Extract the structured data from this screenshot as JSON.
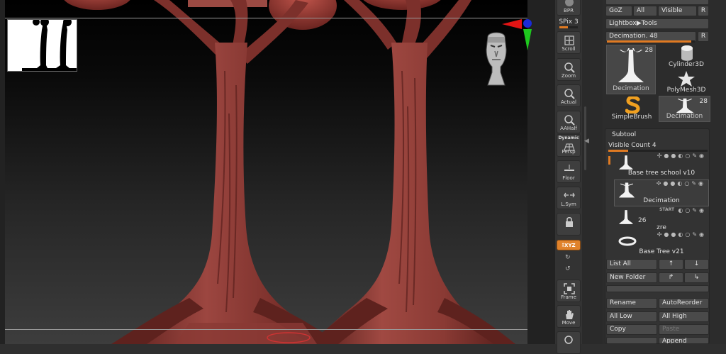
{
  "app": "ZBrush",
  "shelf": {
    "bpr": "BPR",
    "spix": "SPix 3",
    "spix_level": 0.45,
    "scroll": "Scroll",
    "zoom": "Zoom",
    "actual": "Actual",
    "aahalf": "AAHalf",
    "dynamic": "Dynamic",
    "persp": "Persp",
    "floor": "Floor",
    "lsym": "L.Sym",
    "xyz": "⁑XYZ",
    "frame": "Frame",
    "move": "Move"
  },
  "tool_panel": {
    "goz": "GoZ",
    "all": "All",
    "visible": "Visible",
    "r": "R",
    "lightbox_tools": "Lightbox▶Tools",
    "decimation_label": "Decimation.",
    "decimation_value": "48",
    "decimation_level": 0.96,
    "tiles": [
      {
        "name": "Decimation",
        "count": "28"
      },
      {
        "name": "Cylinder3D",
        "count": ""
      },
      {
        "name": "PolyMesh3D",
        "count": ""
      },
      {
        "name": "SimpleBrush",
        "count": ""
      },
      {
        "name": "Decimation",
        "count": "28"
      }
    ]
  },
  "subtool": {
    "title": "Subtool",
    "visible_count_label": "Visible Count 4",
    "visible_count_level": 0.2,
    "items": [
      {
        "name": "Base tree school v10",
        "selected": false
      },
      {
        "name": "Decimation",
        "selected": true
      },
      {
        "name": "zre",
        "selected": false,
        "count": "26",
        "badge": "START"
      },
      {
        "name": "Base Tree v21",
        "selected": false
      }
    ],
    "buttons": {
      "list_all": "List All",
      "new_folder": "New Folder",
      "rename": "Rename",
      "auto_reorder": "AutoReorder",
      "all_low": "All Low",
      "all_high": "All High",
      "copy": "Copy",
      "paste": "Paste",
      "append": "Append"
    }
  },
  "colors": {
    "accent": "#e07a22",
    "tree": "#8e3a34",
    "panel": "#2c2c2c"
  }
}
